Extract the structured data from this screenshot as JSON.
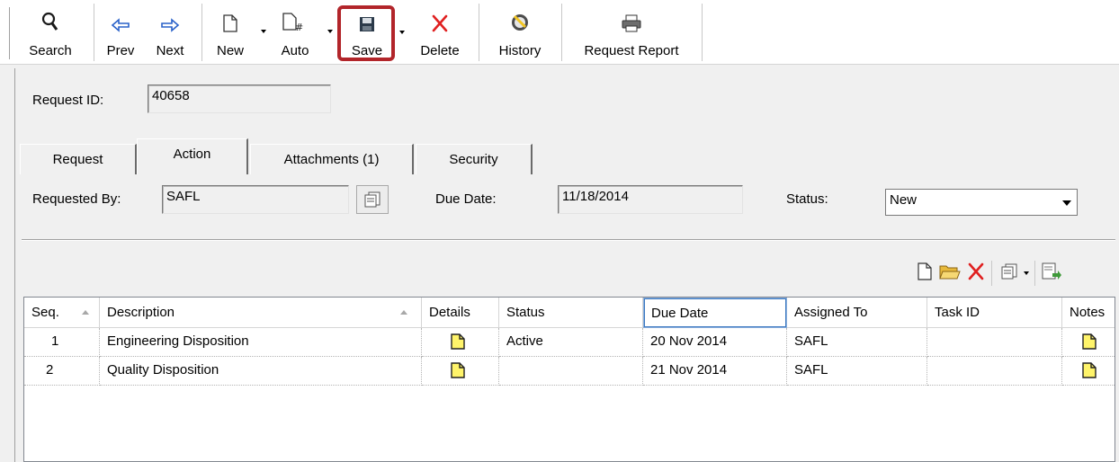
{
  "toolbar": {
    "search": "Search",
    "prev": "Prev",
    "next": "Next",
    "new": "New",
    "auto": "Auto",
    "save": "Save",
    "delete": "Delete",
    "history": "History",
    "request_report": "Request Report"
  },
  "request": {
    "id_label": "Request ID:",
    "id_value": "40658"
  },
  "tabs": [
    {
      "label": "Request",
      "active": false
    },
    {
      "label": "Action",
      "active": true
    },
    {
      "label": "Attachments (1)",
      "active": false
    },
    {
      "label": "Security",
      "active": false
    }
  ],
  "action_form": {
    "requested_by_label": "Requested By:",
    "requested_by_value": "SAFL",
    "due_date_label": "Due Date:",
    "due_date_value": "11/18/2014",
    "status_label": "Status:",
    "status_value": "New"
  },
  "grid": {
    "columns": [
      "Seq.",
      "Description",
      "Details",
      "Status",
      "Due Date",
      "Assigned To",
      "Task ID",
      "Notes"
    ],
    "rows": [
      {
        "seq": "1",
        "description": "Engineering Disposition",
        "status": "Active",
        "due_date": "20 Nov 2014",
        "assigned_to": "SAFL",
        "task_id": ""
      },
      {
        "seq": "2",
        "description": "Quality Disposition",
        "status": "",
        "due_date": "21 Nov 2014",
        "assigned_to": "SAFL",
        "task_id": ""
      }
    ]
  },
  "colors": {
    "save_highlight": "#b2252a",
    "note_yellow": "#fff46a",
    "delete_red": "#e02020",
    "arrow_blue": "#2a62c9"
  }
}
